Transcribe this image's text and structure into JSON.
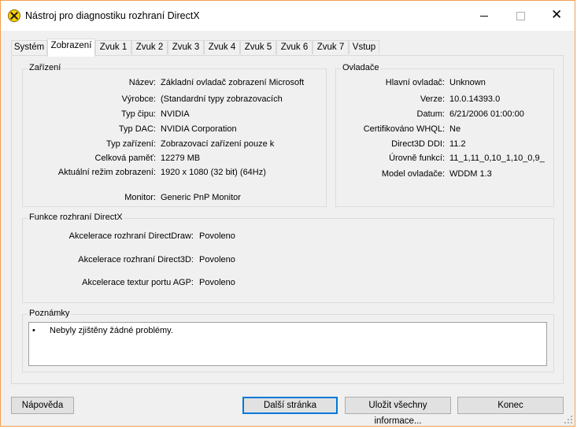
{
  "window": {
    "title": "Nástroj pro diagnostiku rozhraní DirectX",
    "close_glyph": "✕"
  },
  "tabs": [
    {
      "label": "Systém",
      "active": false
    },
    {
      "label": "Zobrazení",
      "active": true
    },
    {
      "label": "Zvuk 1",
      "active": false
    },
    {
      "label": "Zvuk 2",
      "active": false
    },
    {
      "label": "Zvuk 3",
      "active": false
    },
    {
      "label": "Zvuk 4",
      "active": false
    },
    {
      "label": "Zvuk 5",
      "active": false
    },
    {
      "label": "Zvuk 6",
      "active": false
    },
    {
      "label": "Zvuk 7",
      "active": false
    },
    {
      "label": "Vstup",
      "active": false
    }
  ],
  "device": {
    "group_label": "Zařízení",
    "rows": [
      {
        "label": "Název:",
        "value": "Základní ovladač zobrazení Microsoft"
      },
      {
        "label": "Výrobce:",
        "value": "(Standardní typy zobrazovacích"
      },
      {
        "label": "Typ čipu:",
        "value": "NVIDIA"
      },
      {
        "label": "Typ DAC:",
        "value": "NVIDIA Corporation"
      },
      {
        "label": "Typ zařízení:",
        "value": "Zobrazovací zařízení pouze k"
      },
      {
        "label": "Celková paměť:",
        "value": "12279 MB"
      },
      {
        "label": "Aktuální režim zobrazení:",
        "value": "1920 x 1080 (32 bit) (64Hz)"
      },
      {
        "label": "Monitor:",
        "value": "Generic PnP Monitor"
      }
    ]
  },
  "drivers": {
    "group_label": "Ovladače",
    "rows": [
      {
        "label": "Hlavní ovladač:",
        "value": "Unknown"
      },
      {
        "label": "Verze:",
        "value": "10.0.14393.0"
      },
      {
        "label": "Datum:",
        "value": "6/21/2006 01:00:00"
      },
      {
        "label": "Certifikováno WHQL:",
        "value": "Ne"
      },
      {
        "label": "Direct3D DDI:",
        "value": "11.2"
      },
      {
        "label": "Úrovně funkcí:",
        "value": "11_1,11_0,10_1,10_0,9_"
      },
      {
        "label": "Model ovladače:",
        "value": "WDDM 1.3"
      }
    ]
  },
  "features": {
    "group_label": "Funkce rozhraní DirectX",
    "rows": [
      {
        "label": "Akcelerace rozhraní DirectDraw:",
        "value": "Povoleno"
      },
      {
        "label": "Akcelerace rozhraní Direct3D:",
        "value": "Povoleno"
      },
      {
        "label": "Akcelerace textur portu AGP:",
        "value": "Povoleno"
      }
    ]
  },
  "notes": {
    "group_label": "Poznámky",
    "bullet": "•",
    "text": "Nebyly zjištěny žádné problémy."
  },
  "buttons": {
    "help": "Nápověda",
    "next_page": "Další stránka",
    "save_all": "Uložit všechny informace...",
    "exit": "Konec"
  }
}
